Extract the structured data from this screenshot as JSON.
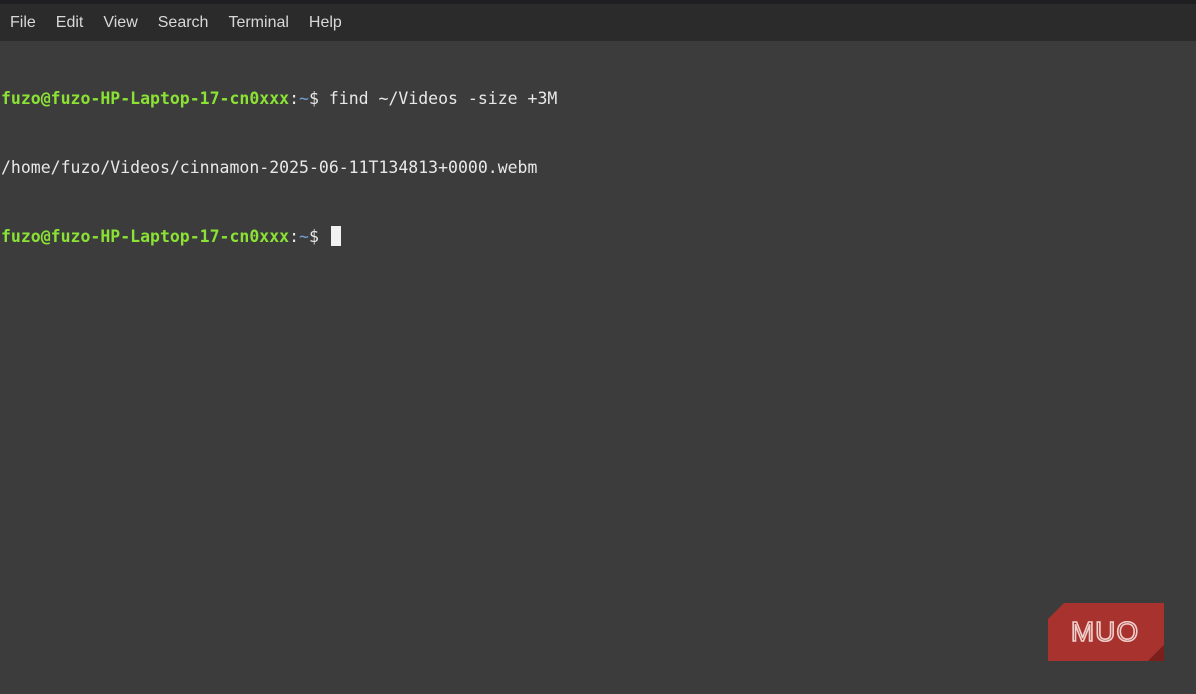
{
  "menubar": {
    "items": [
      "File",
      "Edit",
      "View",
      "Search",
      "Terminal",
      "Help"
    ]
  },
  "terminal": {
    "lines": [
      {
        "user_host": "fuzo@fuzo-HP-Laptop-17-cn0xxx",
        "sep": ":",
        "path": "~",
        "symbol": "$ ",
        "command": "find ~/Videos -size +3M"
      },
      {
        "output": "/home/fuzo/Videos/cinnamon-2025-06-11T134813+0000.webm"
      },
      {
        "user_host": "fuzo@fuzo-HP-Laptop-17-cn0xxx",
        "sep": ":",
        "path": "~",
        "symbol": "$ ",
        "command": ""
      }
    ]
  },
  "watermark": {
    "text": "MUO",
    "color": "#a8322d"
  },
  "colors": {
    "background": "#3c3c3c",
    "menubar": "#2b2b2b",
    "prompt_user": "#8ae234",
    "prompt_path": "#729fcf"
  }
}
